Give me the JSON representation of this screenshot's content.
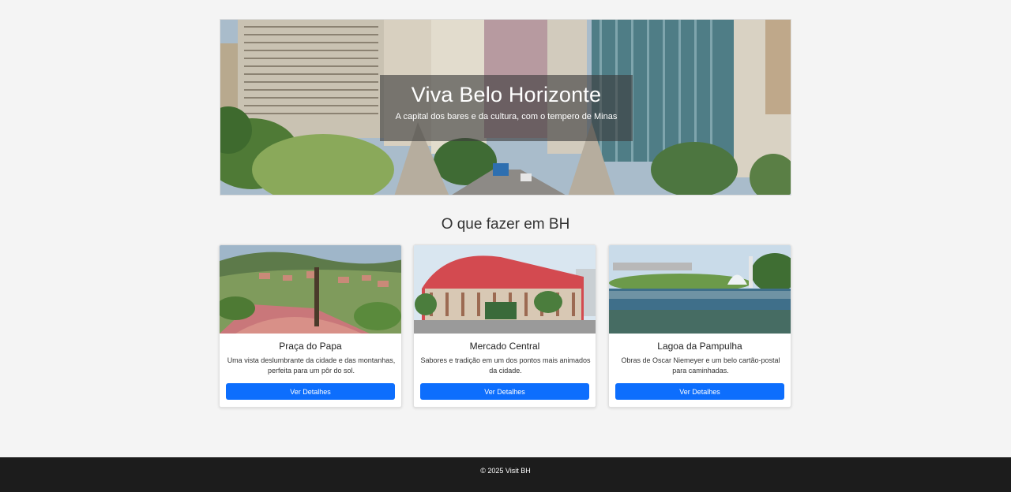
{
  "hero": {
    "title": "Viva Belo Horizonte",
    "subtitle": "A capital dos bares e da cultura, com o tempero de Minas"
  },
  "section": {
    "title": "O que fazer em BH"
  },
  "cards": [
    {
      "title": "Praça do Papa",
      "description": "Uma vista deslumbrante da cidade e das montanhas, perfeita para um pôr do sol.",
      "button": "Ver Detalhes"
    },
    {
      "title": "Mercado Central",
      "description": "Sabores e tradição em um dos pontos mais animados da cidade.",
      "button": "Ver Detalhes"
    },
    {
      "title": "Lagoa da Pampulha",
      "description": "Obras de Oscar Niemeyer e um belo cartão-postal para caminhadas.",
      "button": "Ver Detalhes"
    }
  ],
  "footer": {
    "text": "© 2025 Visit BH"
  },
  "colors": {
    "button": "#0d6efd",
    "footer": "#1c1c1c",
    "background": "#f4f4f4"
  }
}
